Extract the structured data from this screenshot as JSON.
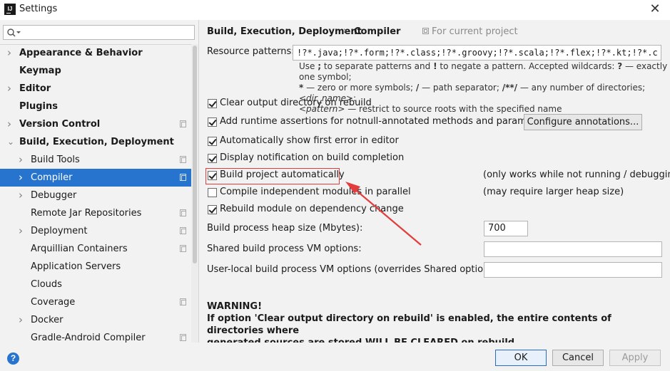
{
  "window": {
    "title": "Settings",
    "app_icon_text": "IJ"
  },
  "search": {
    "placeholder": ""
  },
  "tree": [
    {
      "label": "Appearance & Behavior",
      "bold": true,
      "arrow": "›",
      "level": 0
    },
    {
      "label": "Keymap",
      "bold": true,
      "arrow": "",
      "level": 0
    },
    {
      "label": "Editor",
      "bold": true,
      "arrow": "›",
      "level": 0
    },
    {
      "label": "Plugins",
      "bold": true,
      "arrow": "",
      "level": 0
    },
    {
      "label": "Version Control",
      "bold": true,
      "arrow": "›",
      "level": 0,
      "copy": true
    },
    {
      "label": "Build, Execution, Deployment",
      "bold": true,
      "arrow": "⌄",
      "level": 0
    },
    {
      "label": "Build Tools",
      "arrow": "›",
      "level": 1,
      "copy": true
    },
    {
      "label": "Compiler",
      "arrow": "›",
      "level": 1,
      "copy": true,
      "selected": true
    },
    {
      "label": "Debugger",
      "arrow": "›",
      "level": 1
    },
    {
      "label": "Remote Jar Repositories",
      "arrow": "",
      "level": 1,
      "copy": true
    },
    {
      "label": "Deployment",
      "arrow": "›",
      "level": 1,
      "copy": true
    },
    {
      "label": "Arquillian Containers",
      "arrow": "",
      "level": 1,
      "copy": true
    },
    {
      "label": "Application Servers",
      "arrow": "",
      "level": 1
    },
    {
      "label": "Clouds",
      "arrow": "",
      "level": 1
    },
    {
      "label": "Coverage",
      "arrow": "",
      "level": 1,
      "copy": true
    },
    {
      "label": "Docker",
      "arrow": "›",
      "level": 1
    },
    {
      "label": "Gradle-Android Compiler",
      "arrow": "",
      "level": 1,
      "copy": true
    }
  ],
  "breadcrumb": {
    "parent": "Build, Execution, Deployment",
    "separator": "›",
    "current": "Compiler",
    "scope": "For current project"
  },
  "resource_patterns": {
    "label": "Resource patterns:",
    "value": "!?*.java;!?*.form;!?*.class;!?*.groovy;!?*.scala;!?*.flex;!?*.kt;!?*.c"
  },
  "hint": {
    "line1_a": "Use ",
    "line1_b": ";",
    "line1_c": " to separate patterns and ",
    "line1_d": "!",
    "line1_e": " to negate a pattern. Accepted wildcards: ",
    "line1_f": "?",
    "line1_g": " — exactly one symbol;",
    "line2_a": "*",
    "line2_b": " — zero or more symbols; ",
    "line2_c": "/",
    "line2_d": " — path separator; ",
    "line2_e": "/**/",
    "line2_f": " — any number of directories; ",
    "line2_g": "<dir_name>",
    "line2_h": ":",
    "line3_a": "<pattern>",
    "line3_b": " — restrict to source roots with the specified name"
  },
  "options": [
    {
      "label": "Clear output directory on rebuild",
      "checked": true
    },
    {
      "label": "Add runtime assertions for notnull-annotated methods and parameters",
      "checked": true
    },
    {
      "label": "Automatically show first error in editor",
      "checked": true
    },
    {
      "label": "Display notification on build completion",
      "checked": true
    },
    {
      "label": "Build project automatically",
      "checked": true,
      "note": "(only works while not running / debugging)"
    },
    {
      "label": "Compile independent modules in parallel",
      "checked": false,
      "note": "(may require larger heap size)"
    },
    {
      "label": "Rebuild module on dependency change",
      "checked": true
    }
  ],
  "configure_annotations": "Configure annotations...",
  "heap": {
    "label": "Build process heap size (Mbytes):",
    "value": "700"
  },
  "shared_vm": {
    "label": "Shared build process VM options:",
    "value": ""
  },
  "user_vm": {
    "label": "User-local build process VM options (overrides Shared options):",
    "value": ""
  },
  "warning": {
    "title": "WARNING!",
    "line1": "If option 'Clear output directory on rebuild' is enabled, the entire contents of directories where",
    "line2": "generated sources are stored WILL BE CLEARED on rebuild."
  },
  "buttons": {
    "ok": "OK",
    "cancel": "Cancel",
    "apply": "Apply",
    "help": "?"
  },
  "colors": {
    "selection": "#2774ce",
    "annotation": "#e33c3c"
  }
}
